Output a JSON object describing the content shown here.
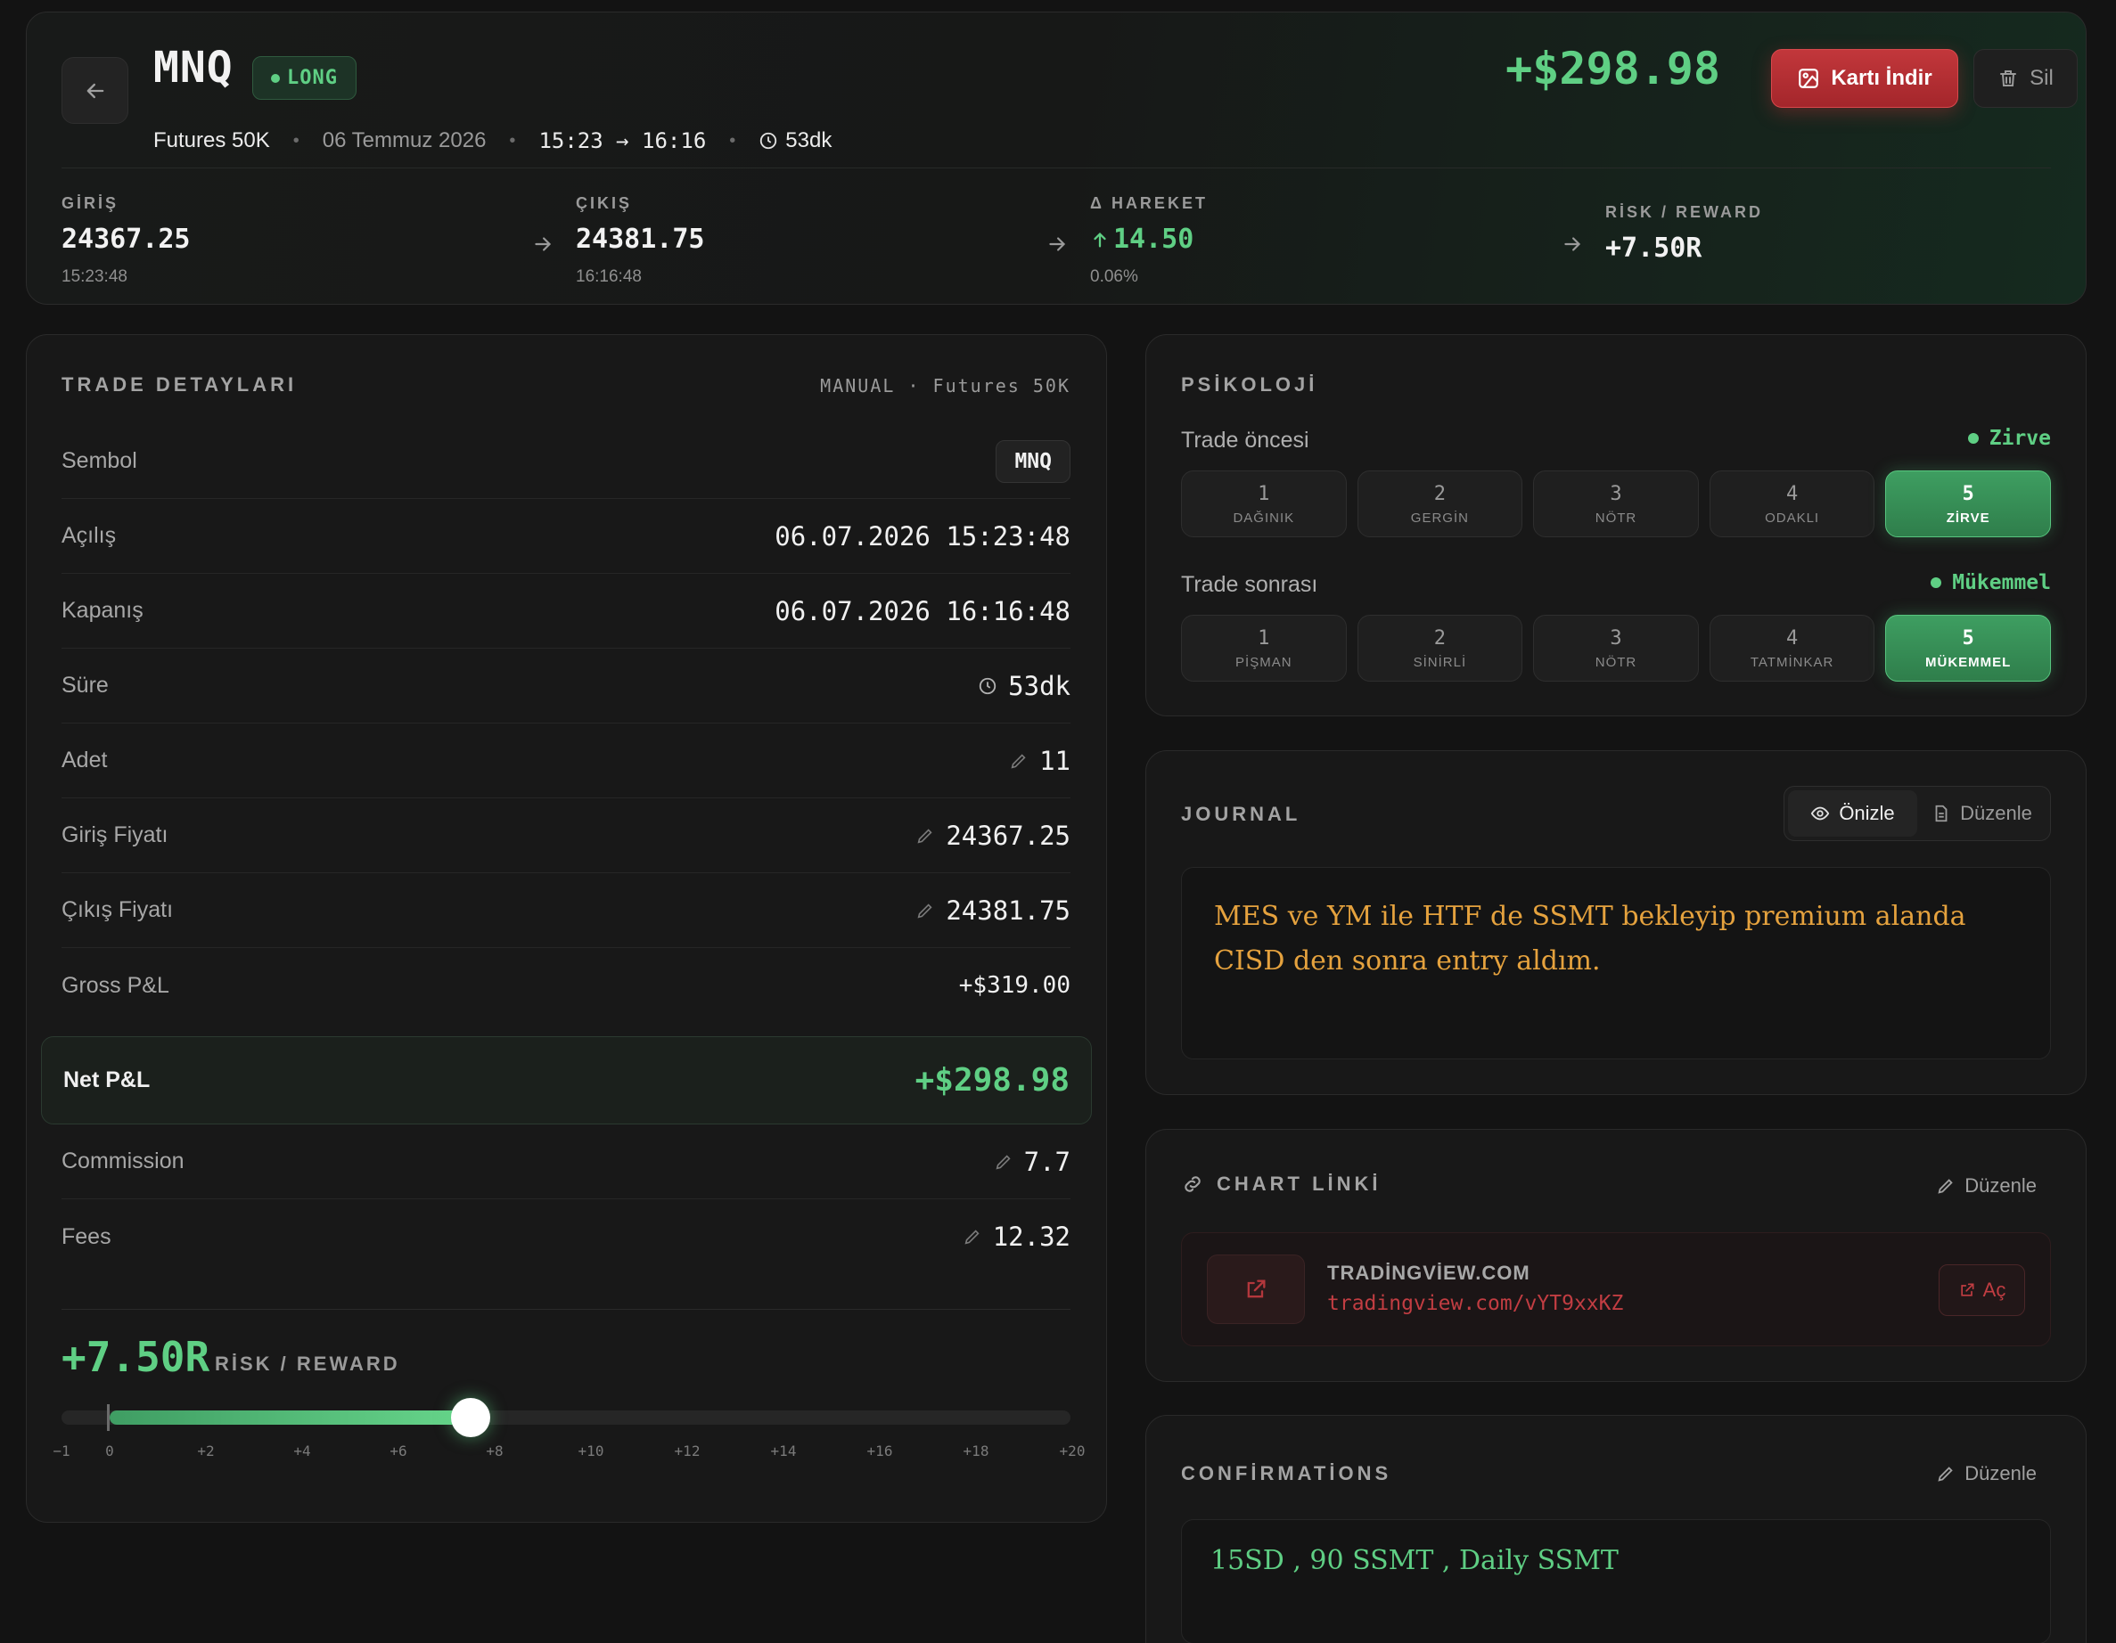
{
  "header": {
    "symbol": "MNQ",
    "direction": "LONG",
    "account": "Futures 50K",
    "date": "06 Temmuz 2026",
    "time_range": "15:23 → 16:16",
    "duration": "53dk",
    "net_pnl": "+$298.98",
    "download_label": "Kartı İndir",
    "delete_label": "Sil",
    "stats": [
      {
        "label": "GİRİŞ",
        "value": "24367.25",
        "sub": "15:23:48"
      },
      {
        "label": "ÇIKIŞ",
        "value": "24381.75",
        "sub": "16:16:48"
      },
      {
        "label": "Δ HAREKET",
        "value": "14.50",
        "sub": "0.06%"
      },
      {
        "label": "RİSK / REWARD",
        "value": "+7.50R",
        "sub": ""
      }
    ]
  },
  "details": {
    "title": "TRADE DETAYLARI",
    "meta": "MANUAL · Futures 50K",
    "rows": [
      {
        "label": "Sembol",
        "value": "MNQ"
      },
      {
        "label": "Açılış",
        "value": "06.07.2026 15:23:48"
      },
      {
        "label": "Kapanış",
        "value": "06.07.2026 16:16:48"
      },
      {
        "label": "Süre",
        "value": "53dk"
      },
      {
        "label": "Adet",
        "value": "11"
      },
      {
        "label": "Giriş Fiyatı",
        "value": "24367.25"
      },
      {
        "label": "Çıkış Fiyatı",
        "value": "24381.75"
      },
      {
        "label": "Gross P&L",
        "value": "+$319.00"
      }
    ],
    "net_pnl_label": "Net P&L",
    "net_pnl_value": "+$298.98",
    "rows2": [
      {
        "label": "Commission",
        "value": "7.7"
      },
      {
        "label": "Fees",
        "value": "12.32"
      }
    ],
    "rr_value": "+7.50R",
    "rr_label": "RİSK / REWARD",
    "rr_numeric": 7.5,
    "rr_ticks": [
      "−1",
      "0",
      "+2",
      "+4",
      "+6",
      "+8",
      "+10",
      "+12",
      "+14",
      "+16",
      "+18",
      "+20"
    ]
  },
  "psychology": {
    "title": "PSİKOLOJİ",
    "before_label": "Trade öncesi",
    "before_status": "Zirve",
    "before_options": [
      {
        "n": "1",
        "t": "DAĞINIK"
      },
      {
        "n": "2",
        "t": "GERGİN"
      },
      {
        "n": "3",
        "t": "NÖTR"
      },
      {
        "n": "4",
        "t": "ODAKLI"
      },
      {
        "n": "5",
        "t": "ZİRVE"
      }
    ],
    "before_selected": 5,
    "after_label": "Trade sonrası",
    "after_status": "Mükemmel",
    "after_options": [
      {
        "n": "1",
        "t": "PİŞMAN"
      },
      {
        "n": "2",
        "t": "SİNİRLİ"
      },
      {
        "n": "3",
        "t": "NÖTR"
      },
      {
        "n": "4",
        "t": "TATMİNKAR"
      },
      {
        "n": "5",
        "t": "MÜKEMMEL"
      }
    ],
    "after_selected": 5
  },
  "journal": {
    "title": "JOURNAL",
    "preview_label": "Önizle",
    "edit_label": "Düzenle",
    "text": "MES ve YM ile HTF  de SSMT bekleyip premium alanda CISD den sonra entry aldım."
  },
  "chart_link": {
    "title": "CHART LİNKİ",
    "edit_label": "Düzenle",
    "domain": "TRADİNGVİEW.COM",
    "url": "tradingview.com/vYT9xxKZ",
    "open_label": "Aç"
  },
  "confirmations": {
    "title": "CONFİRMATİONS",
    "edit_label": "Düzenle",
    "text": "15SD , 90 SSMT , Daily SSMT"
  },
  "colors": {
    "accent_green": "#5fcf84",
    "accent_red": "#c13d42",
    "journal_orange": "#e5a23e",
    "background": "#131313"
  }
}
